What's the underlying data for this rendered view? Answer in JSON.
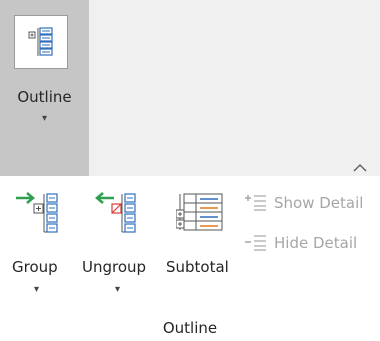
{
  "collapsed": {
    "button_label": "Outline",
    "dropdown_glyph": "▾",
    "icon": "outline-grid-icon",
    "chevron": "chevron-up-icon"
  },
  "group": {
    "caption": "Outline",
    "buttons": [
      {
        "label": "Group",
        "dropdown_glyph": "▾",
        "icon": "group-icon"
      },
      {
        "label": "Ungroup",
        "dropdown_glyph": "▾",
        "icon": "ungroup-icon"
      },
      {
        "label": "Subtotal",
        "icon": "subtotal-icon"
      }
    ],
    "small_commands": [
      {
        "label": "Show Detail",
        "icon": "show-detail-icon",
        "enabled": false
      },
      {
        "label": "Hide Detail",
        "icon": "hide-detail-icon",
        "enabled": false
      }
    ]
  },
  "colors": {
    "accent_green": "#2e9e4f",
    "accent_red": "#d83b3b",
    "accent_blue": "#2f6fbf",
    "accent_orange": "#e07b1a",
    "disabled_text": "#a6a6a6",
    "selected_bg": "#c6c6c6",
    "strip_bg": "#f0f0f0"
  }
}
